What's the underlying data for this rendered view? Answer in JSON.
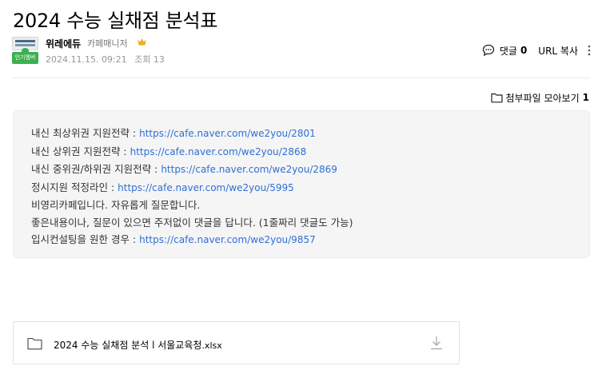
{
  "post": {
    "title": "2024 수능 실채점 분석표",
    "author": {
      "nickname": "위레에듀",
      "role": "카페매니저",
      "badge": "인기멤버",
      "date": "2024.11.15. 09:21",
      "views_label": "조회 13"
    },
    "actions": {
      "comment_label": "댓글",
      "comment_count": "0",
      "url_copy": "URL 복사"
    },
    "attachments_collect": {
      "label": "첨부파일 모아보기",
      "count": "1"
    },
    "content_lines": [
      {
        "text": "내신 최상위권 지원전략 : ",
        "link": "https://cafe.naver.com/we2you/2801"
      },
      {
        "text": "내신 상위권 지원전략 : ",
        "link": "https://cafe.naver.com/we2you/2868"
      },
      {
        "text": "내신 중위권/하위권 지원전략 : ",
        "link": "https://cafe.naver.com/we2you/2869"
      },
      {
        "text": "정시지원 적정라인 : ",
        "link": "https://cafe.naver.com/we2you/5995"
      },
      {
        "text": "비영리카페입니다. 자유롭게 질문합니다.",
        "link": ""
      },
      {
        "text": "좋은내용이나, 질문이 있으면 주저없이 댓글을 답니다. (1줄짜리 댓글도 가능)",
        "link": ""
      },
      {
        "text": "입시컨설팅을 원한 경우 : ",
        "link": "https://cafe.naver.com/we2you/9857"
      }
    ],
    "file": {
      "name": "2024 수능 실채점 분석 l 서울교육청",
      "ext": ".xlsx"
    }
  },
  "colors": {
    "link": "#2f6fd6",
    "badge_green": "#3bb04f",
    "crown_yellow": "#f2b418"
  },
  "icons": {
    "comment": "comment-bubble-icon",
    "more": "more-vertical-icon",
    "folder": "folder-icon",
    "download": "download-icon",
    "crown": "crown-icon"
  }
}
